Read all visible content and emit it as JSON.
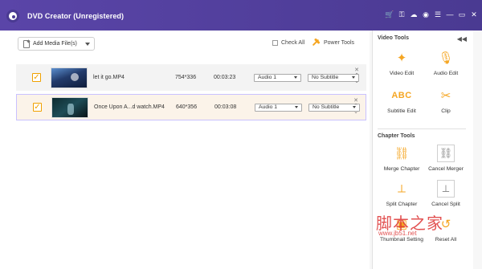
{
  "window": {
    "title": "DVD Creator (Unregistered)"
  },
  "header_icons": [
    "cart-icon",
    "key-icon",
    "cloud-icon",
    "user-icon",
    "menu-icon",
    "minimize-icon",
    "restore-icon",
    "close-icon"
  ],
  "toolbar": {
    "add_media_label": "Add Media File(s)",
    "check_all_label": "Check All",
    "power_tools_label": "Power Tools"
  },
  "files": [
    {
      "name": "let it go.MP4",
      "resolution": "754*336",
      "duration": "00:03:23",
      "audio": "Audio 1",
      "subtitle": "No Subtitle",
      "checked": true
    },
    {
      "name": "Once Upon A...d watch.MP4",
      "resolution": "640*356",
      "duration": "00:03:08",
      "audio": "Audio 1",
      "subtitle": "No Subtitle",
      "checked": true
    }
  ],
  "sidebar": {
    "video_tools_title": "Video Tools",
    "chapter_tools_title": "Chapter Tools",
    "video_tools": [
      {
        "label": "Video Edit",
        "icon": "magic-wand-icon"
      },
      {
        "label": "Audio Edit",
        "icon": "microphone-icon"
      },
      {
        "label": "Subtitle Edit",
        "icon": "subtitle-icon",
        "text": "ABC"
      },
      {
        "label": "Clip",
        "icon": "scissors-icon"
      }
    ],
    "chapter_tools": [
      {
        "label": "Merge Chapter",
        "icon": "merge-icon"
      },
      {
        "label": "Cancel Merger",
        "icon": "cancel-merge-icon"
      },
      {
        "label": "Split Chapter",
        "icon": "split-icon"
      },
      {
        "label": "Cancel Split",
        "icon": "cancel-split-icon"
      },
      {
        "label": "Thumbnail Setting",
        "icon": "thumbnail-icon"
      },
      {
        "label": "Reset All",
        "icon": "reset-icon"
      }
    ]
  },
  "watermark": {
    "text": "脚本之家",
    "url": "www.jb51.net"
  },
  "colors": {
    "titlebar": "#4f3f98",
    "accent": "#f5a623",
    "selected_border": "#c9c1ff"
  }
}
